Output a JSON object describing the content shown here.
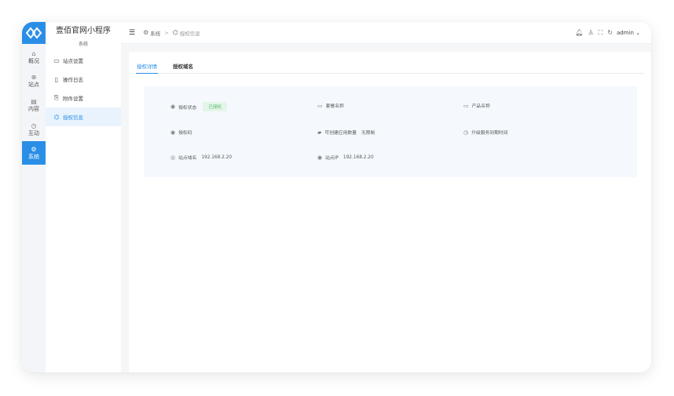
{
  "app": {
    "title": "壹佰官网小程序",
    "section": "系统"
  },
  "rail": {
    "items": [
      {
        "label": "概况",
        "icon": "home-icon",
        "glyph": "⌂"
      },
      {
        "label": "站点",
        "icon": "globe-icon",
        "glyph": "⊕"
      },
      {
        "label": "内容",
        "icon": "document-icon",
        "glyph": "▤"
      },
      {
        "label": "互动",
        "icon": "chat-icon",
        "glyph": "◷"
      },
      {
        "label": "系统",
        "icon": "settings-icon",
        "glyph": "⚙",
        "active": true
      }
    ]
  },
  "submenu": {
    "items": [
      {
        "label": "站点设置",
        "icon": "monitor-icon",
        "glyph": "▭"
      },
      {
        "label": "操作日志",
        "icon": "log-icon",
        "glyph": "▯"
      },
      {
        "label": "附件设置",
        "icon": "paperclip-icon",
        "glyph": "⎘"
      },
      {
        "label": "授权信息",
        "icon": "key-card-icon",
        "glyph": "⌬",
        "active": true
      }
    ]
  },
  "breadcrumb": {
    "root": "系统",
    "current": "授权信息",
    "separator": ">"
  },
  "topbar": {
    "user": "admin"
  },
  "tabs": [
    {
      "label": "授权详情",
      "active": true
    },
    {
      "label": "授权域名",
      "active": false
    }
  ],
  "info": {
    "auth_status": {
      "label": "授权状态",
      "value": "已授权"
    },
    "package_name": {
      "label": "套餐名称",
      "value": ""
    },
    "product_name": {
      "label": "产品名称",
      "value": ""
    },
    "auth_code": {
      "label": "授权码",
      "value": ""
    },
    "app_quota": {
      "label": "可创建应用数量",
      "value": "无限制"
    },
    "upgrade_expiry": {
      "label": "升级服务到期时间",
      "value": ""
    },
    "site_domain": {
      "label": "站点域名",
      "value": "192.168.2.20"
    },
    "site_ip": {
      "label": "站点IP",
      "value": "192.168.2.20"
    }
  },
  "colors": {
    "accent": "#2b8ee6",
    "success_bg": "#e3f6e8",
    "success_text": "#54b86d",
    "panel_bg": "#f5f9fe"
  }
}
